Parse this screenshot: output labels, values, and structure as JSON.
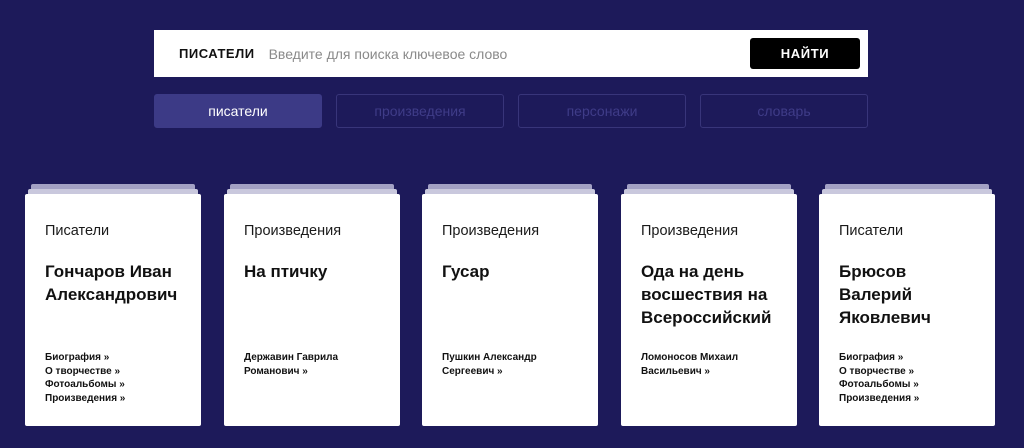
{
  "search": {
    "label": "ПИСАТЕЛИ",
    "placeholder": "Введите для поиска ключевое слово",
    "value": "",
    "button_label": "НАЙТИ"
  },
  "tabs": [
    {
      "label": "писатели",
      "active": true
    },
    {
      "label": "произведения",
      "active": false
    },
    {
      "label": "персонажи",
      "active": false
    },
    {
      "label": "словарь",
      "active": false
    }
  ],
  "cards": [
    {
      "category": "Писатели",
      "title": "Гончаров Иван Александрович",
      "links": [
        "Биография »",
        "О творчестве »",
        "Фотоальбомы »",
        "Произведения »"
      ]
    },
    {
      "category": "Произведения",
      "title": "На птичку",
      "links": [
        "Державин Гаврила Романович »"
      ]
    },
    {
      "category": "Произведения",
      "title": "Гусар",
      "links": [
        "Пушкин Александр Сергеевич »"
      ]
    },
    {
      "category": "Произведения",
      "title": "Ода на день восшествия на Всероссийский",
      "links": [
        "Ломоносов Михаил Васильевич »"
      ]
    },
    {
      "category": "Писатели",
      "title": "Брюсов Валерий Яковлевич",
      "links": [
        "Биография »",
        "О творчестве »",
        "Фотоальбомы »",
        "Произведения »"
      ]
    }
  ],
  "colors": {
    "background": "#1d1a5a",
    "tab_active": "#3c3a86",
    "tab_inactive_text": "#3f3c88",
    "button": "#000000",
    "card": "#ffffff"
  }
}
